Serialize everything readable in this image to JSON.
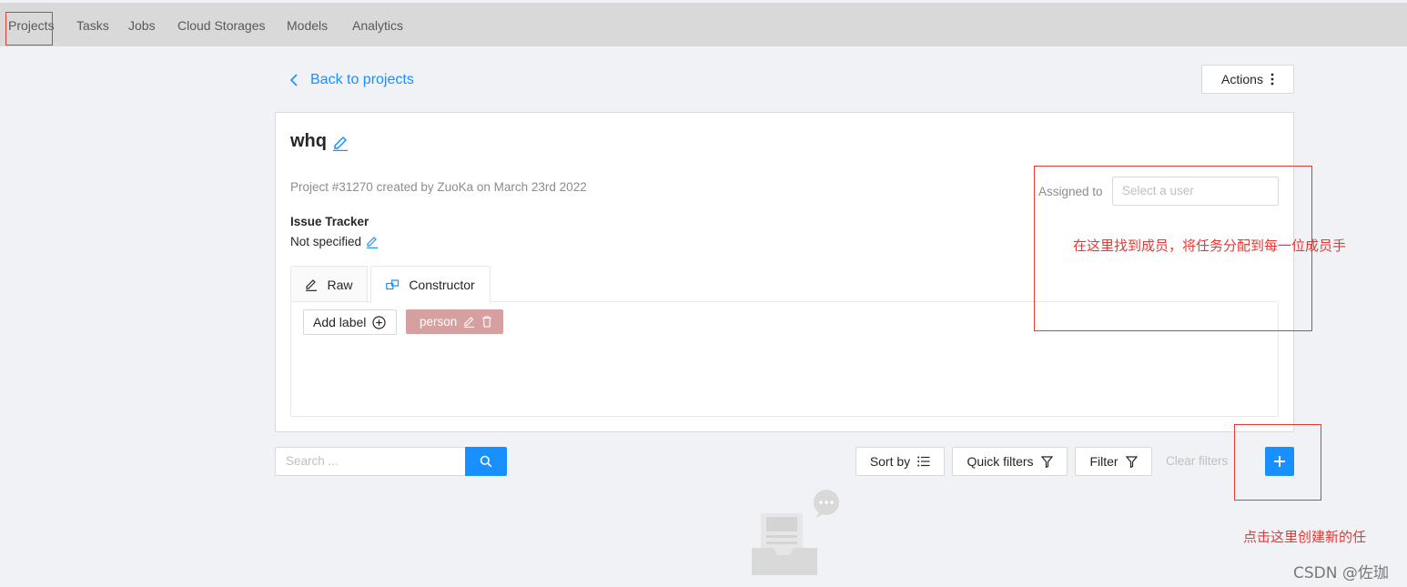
{
  "nav": {
    "items": [
      {
        "label": "Projects",
        "active": true
      },
      {
        "label": "Tasks"
      },
      {
        "label": "Jobs"
      },
      {
        "label": "Cloud Storages"
      },
      {
        "label": "Models"
      },
      {
        "label": "Analytics"
      }
    ]
  },
  "header": {
    "back_label": "Back to projects",
    "actions_label": "Actions"
  },
  "project": {
    "name": "whq",
    "meta": "Project #31270 created by ZuoKa on March 23rd 2022",
    "assigned_label": "Assigned to",
    "assignee_placeholder": "Select a user",
    "issue_tracker_title": "Issue Tracker",
    "issue_tracker_value": "Not specified"
  },
  "tabs": [
    {
      "label": "Raw"
    },
    {
      "label": "Constructor",
      "active": true
    }
  ],
  "labels": {
    "add_label": "Add label",
    "items": [
      {
        "name": "person",
        "color": "#d6a0a0"
      }
    ]
  },
  "toolbar": {
    "search_placeholder": "Search ...",
    "sort_label": "Sort by",
    "quick_filters_label": "Quick filters",
    "filter_label": "Filter",
    "clear_filters_label": "Clear filters"
  },
  "annotations": {
    "assign_note": "在这里找到成员，将任务分配到每一位成员手",
    "create_note": "点击这里创建新的任"
  },
  "watermark": "CSDN @佐珈",
  "colors": {
    "accent": "#1890ff",
    "annotation": "#e53935",
    "label_person": "#d6a0a0",
    "topbar": "#d9d9d9"
  }
}
